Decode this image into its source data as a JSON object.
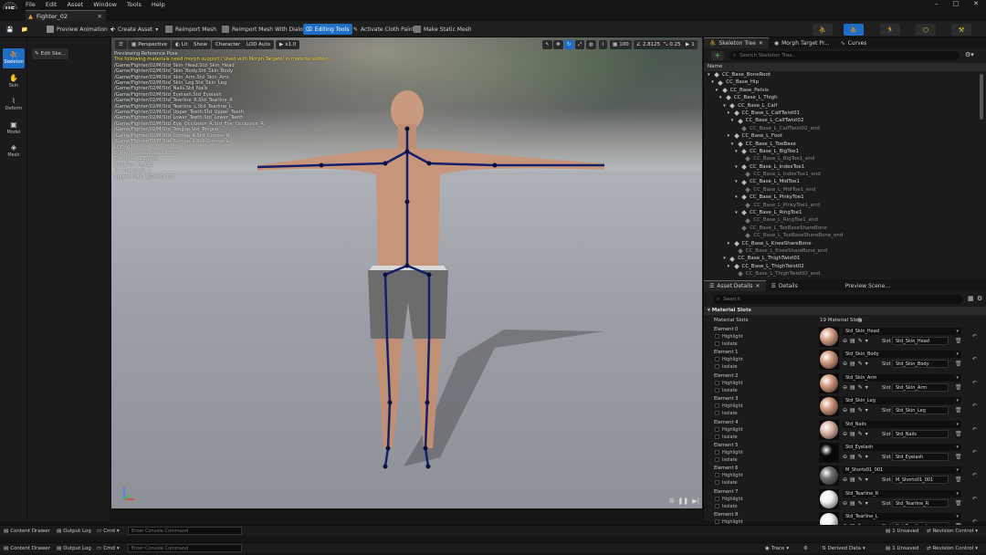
{
  "menu": {
    "items": [
      "File",
      "Edit",
      "Asset",
      "Window",
      "Tools",
      "Help"
    ],
    "logo": "UE"
  },
  "tab": {
    "title": "Fighter_02"
  },
  "toolbar": {
    "preview_animation": "Preview Animation",
    "create_asset": "Create Asset",
    "reimport_mesh": "Reimport Mesh",
    "reimport_dialog": "Reimport Mesh With Dialog",
    "editing_tools": "Editing Tools",
    "cloth_paint": "Activate Cloth Paint",
    "make_static": "Make Static Mesh"
  },
  "rail": [
    {
      "label": "Skeleton",
      "glyph": "⛹"
    },
    {
      "label": "Skin",
      "glyph": "✋"
    },
    {
      "label": "Deform",
      "glyph": "⌇"
    },
    {
      "label": "Model",
      "glyph": "▣"
    },
    {
      "label": "Mesh",
      "glyph": "◈"
    }
  ],
  "subpanel": {
    "edit_skeleton": "Edit Ske..."
  },
  "viewport": {
    "perspective": "Perspective",
    "lit": "Lit",
    "show": "Show",
    "character": "Character",
    "lod": "LOD Auto",
    "speed": "x1.0",
    "fov": "100",
    "angle": "2.8125",
    "scale": "0.25",
    "cam": "1",
    "overlay_title": "Previewing Reference Pose",
    "overlay_warning": "The following materials need morph support ('Used with Morph Targets' in material editor):",
    "overlay_lines": [
      "/Game/Fighter/02/M/Std_Skin_Head.Std_Skin_Head",
      "/Game/Fighter/02/M/Std_Skin_Body.Std_Skin_Body",
      "/Game/Fighter/02/M/Std_Skin_Arm.Std_Skin_Arm",
      "/Game/Fighter/02/M/Std_Skin_Leg.Std_Skin_Leg",
      "/Game/Fighter/02/M/Std_Nails.Std_Nails",
      "/Game/Fighter/02/M/Std_Eyelash.Std_Eyelash",
      "/Game/Fighter/02/M/Std_Tearline_R.Std_Tearline_R",
      "/Game/Fighter/02/M/Std_Tearline_L.Std_Tearline_L",
      "/Game/Fighter/02/M/Std_Upper_Teeth.Std_Upper_Teeth",
      "/Game/Fighter/02/M/Std_Lower_Teeth.Std_Lower_Teeth",
      "/Game/Fighter/02/M/Std_Eye_Occlusion_R.Std_Eye_Occlusion_R",
      "/Game/Fighter/02/M/Std_Tongue.Std_Tongue",
      "/Game/Fighter/02/M/Std_Cornea_R.Std_Cornea_R",
      "/Game/Fighter/02/M/Std_Cornea_L.Std_Cornea_L"
    ],
    "stats": [
      "LOD: 0",
      "Current Screen Size: 1.173",
      "Triangles: 136,362",
      "Vertices: 74,328",
      "UV Channels: 2",
      "Approx Size: 100x56x181"
    ]
  },
  "skeleton_panel": {
    "tabs": [
      "Skeleton Tree",
      "Morph Target Pr...",
      "Curves"
    ],
    "search_placeholder": "Search Skeleton Tree...",
    "column": "Name",
    "bones": [
      {
        "name": "CC_Base_BoneRoot",
        "depth": 0,
        "end": false
      },
      {
        "name": "CC_Base_Hip",
        "depth": 1,
        "end": false
      },
      {
        "name": "CC_Base_Pelvis",
        "depth": 2,
        "end": false
      },
      {
        "name": "CC_Base_L_Thigh",
        "depth": 3,
        "end": false
      },
      {
        "name": "CC_Base_L_Calf",
        "depth": 4,
        "end": false
      },
      {
        "name": "CC_Base_L_CalfTwist01",
        "depth": 5,
        "end": false
      },
      {
        "name": "CC_Base_L_CalfTwist02",
        "depth": 6,
        "end": false
      },
      {
        "name": "CC_Base_L_CalfTwist02_end",
        "depth": 7,
        "end": true
      },
      {
        "name": "CC_Base_L_Foot",
        "depth": 5,
        "end": false
      },
      {
        "name": "CC_Base_L_ToeBase",
        "depth": 6,
        "end": false
      },
      {
        "name": "CC_Base_L_BigToe1",
        "depth": 7,
        "end": false
      },
      {
        "name": "CC_Base_L_BigToe1_end",
        "depth": 8,
        "end": true
      },
      {
        "name": "CC_Base_L_IndexToe1",
        "depth": 7,
        "end": false
      },
      {
        "name": "CC_Base_L_IndexToe1_end",
        "depth": 8,
        "end": true
      },
      {
        "name": "CC_Base_L_MidToe1",
        "depth": 7,
        "end": false
      },
      {
        "name": "CC_Base_L_MidToe1_end",
        "depth": 8,
        "end": true
      },
      {
        "name": "CC_Base_L_PinkyToe1",
        "depth": 7,
        "end": false
      },
      {
        "name": "CC_Base_L_PinkyToe1_end",
        "depth": 8,
        "end": true
      },
      {
        "name": "CC_Base_L_RingToe1",
        "depth": 7,
        "end": false
      },
      {
        "name": "CC_Base_L_RingToe1_end",
        "depth": 8,
        "end": true
      },
      {
        "name": "CC_Base_L_ToeBaseShareBone",
        "depth": 7,
        "end": true
      },
      {
        "name": "CC_Base_L_ToeBaseShareBone_end",
        "depth": 8,
        "end": true
      },
      {
        "name": "CC_Base_L_KneeShareBone",
        "depth": 5,
        "end": false
      },
      {
        "name": "CC_Base_L_KneeShareBone_end",
        "depth": 6,
        "end": true
      },
      {
        "name": "CC_Base_L_ThighTwist01",
        "depth": 4,
        "end": false
      },
      {
        "name": "CC_Base_L_ThighTwist02",
        "depth": 5,
        "end": false
      },
      {
        "name": "CC_Base_L_ThighTwist02_end",
        "depth": 6,
        "end": true
      }
    ]
  },
  "details_panel": {
    "tabs": [
      "Asset Details",
      "Details",
      "Preview Scene..."
    ],
    "search_placeholder": "Search",
    "section": "Material Slots",
    "slots_label": "Material Slots",
    "slots_count": "19 Material Slots",
    "highlight": "Highlight",
    "isolate": "Isolate",
    "slot_label": "Slot",
    "elements": [
      {
        "label": "Element 0",
        "material": "Std_Skin_Head",
        "slot": "Std_Skin_Head",
        "color": "#d8a085"
      },
      {
        "label": "Element 1",
        "material": "Std_Skin_Body",
        "slot": "Std_Skin_Body",
        "color": "#d49a80"
      },
      {
        "label": "Element 2",
        "material": "Std_Skin_Arm",
        "slot": "Std_Skin_Arm",
        "color": "#d49a80"
      },
      {
        "label": "Element 3",
        "material": "Std_Skin_Leg",
        "slot": "Std_Skin_Leg",
        "color": "#d0987e"
      },
      {
        "label": "Element 4",
        "material": "Std_Nails",
        "slot": "Std_Nails",
        "color": "#dcb6a6"
      },
      {
        "label": "Element 5",
        "material": "Std_Eyelash",
        "slot": "Std_Eyelash",
        "color": "#0a0a0a"
      },
      {
        "label": "Element 6",
        "material": "M_Shorts01_001",
        "slot": "M_Shorts01_001",
        "color": "#6f6f6f"
      },
      {
        "label": "Element 7",
        "material": "Std_Tearline_R",
        "slot": "Std_Tearline_R",
        "color": "#f2f2f2"
      },
      {
        "label": "Element 8",
        "material": "Std_Tearline_L",
        "slot": "Std_Tearline_L",
        "color": "#f0f0f0"
      }
    ]
  },
  "status": {
    "content_drawer": "Content Drawer",
    "output_log": "Output Log",
    "cmd": "Cmd",
    "console_placeholder": "Enter Console Command",
    "unsaved": "1 Unsaved",
    "revision": "Revision Control",
    "trace": "Trace",
    "derived": "Derived Data"
  },
  "colors": {
    "accent": "#1e6ec7",
    "bone": "#14206a"
  }
}
